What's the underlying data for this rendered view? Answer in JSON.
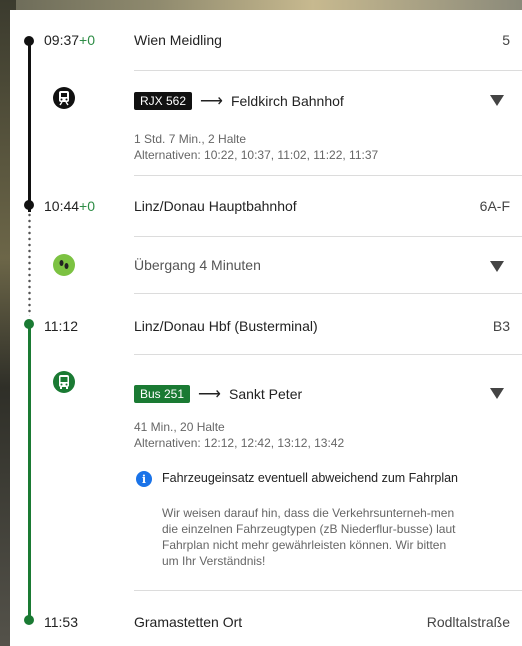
{
  "stops": [
    {
      "time": "09:37",
      "delay": "+0",
      "station": "Wien Meidling",
      "platform": "5"
    },
    {
      "time": "10:44",
      "delay": "+0",
      "station": "Linz/Donau Hauptbahnhof",
      "platform": "6A-F"
    },
    {
      "time": "11:12",
      "delay": "",
      "station": "Linz/Donau Hbf (Busterminal)",
      "platform": "B3"
    },
    {
      "time": "11:53",
      "delay": "",
      "station": "Gramastetten Ort",
      "platform": "Rodltalstraße"
    }
  ],
  "legs": [
    {
      "icon": "train-icon",
      "line": "RJX 562",
      "line_color": "#000000",
      "arrow": "⟶",
      "destination": "Feldkirch Bahnhof",
      "duration": "1 Std. 7 Min., 2 Halte",
      "alternatives": "Alternativen: 10:22, 10:37, 11:02, 11:22, 11:37"
    },
    {
      "icon": "footsteps-icon",
      "transfer": "Übergang 4 Minuten"
    },
    {
      "icon": "bus-icon",
      "line": "Bus 251",
      "line_color": "#1a7a33",
      "arrow": "⟶",
      "destination": "Sankt Peter",
      "duration": "41 Min., 20 Halte",
      "alternatives": "Alternativen: 12:12, 12:42, 13:12, 13:42",
      "notice": {
        "title": "Fahrzeugeinsatz eventuell abweichend zum Fahrplan",
        "text": "Wir weisen darauf hin, dass die Verkehrsunterneh-men die einzelnen Fahrzeugtypen (zB Niederflur-busse) laut Fahrplan nicht mehr gewährleisten können. Wir bitten um Ihr Verständnis!"
      }
    }
  ],
  "colors": {
    "train": "#000000",
    "bus": "#1a7a33",
    "walk": "#7cc242",
    "delay": "#2d8c45",
    "info": "#1a73e8"
  }
}
